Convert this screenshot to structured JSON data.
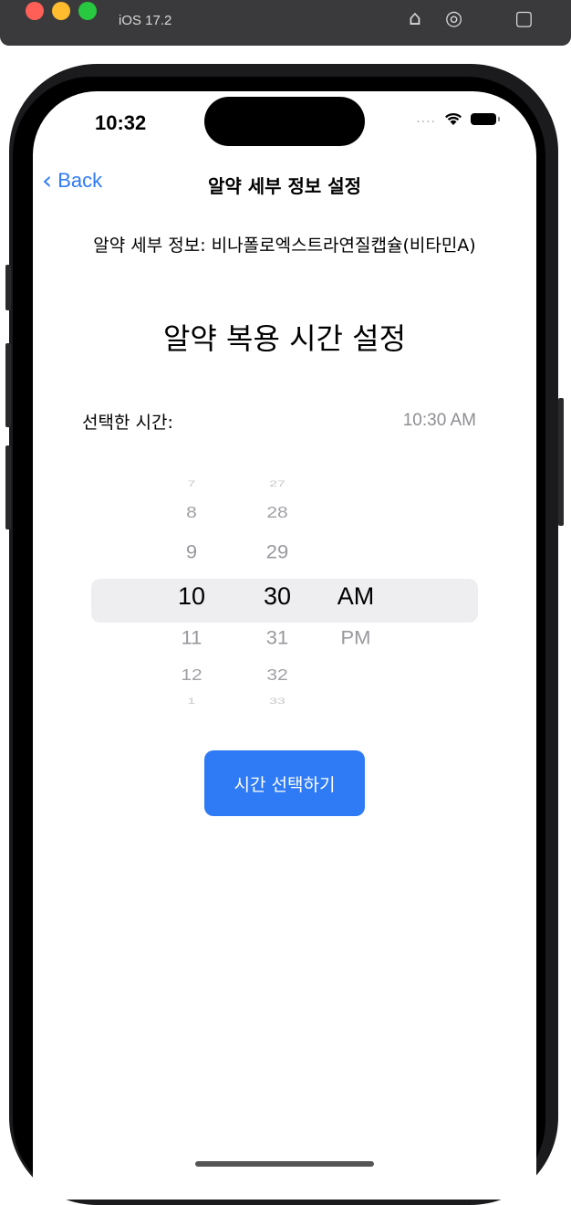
{
  "simulator": {
    "os_label": "iOS 17.2"
  },
  "status_bar": {
    "time": "10:32",
    "dots": "....",
    "wifi_icon": "wifi-icon",
    "battery_icon": "battery-icon"
  },
  "nav": {
    "back_label": "Back",
    "title": "알약 세부 정보 설정"
  },
  "detail": {
    "text": "알약 세부 정보: 비나폴로엑스트라연질캡슐(비타민A)"
  },
  "section": {
    "title": "알약 복용 시간 설정"
  },
  "selected": {
    "label": "선택한 시간:",
    "value": "10:30 AM"
  },
  "picker": {
    "hours": [
      "7",
      "8",
      "9",
      "10",
      "11",
      "12",
      "1"
    ],
    "minutes": [
      "27",
      "28",
      "29",
      "30",
      "31",
      "32",
      "33"
    ],
    "ampm": [
      "AM",
      "PM"
    ],
    "selected_index": 3
  },
  "button": {
    "label": "시간 선택하기"
  },
  "colors": {
    "accent": "#2f7bf5",
    "secondary_text": "#8e8e93",
    "picker_highlight": "#eeeef0"
  }
}
